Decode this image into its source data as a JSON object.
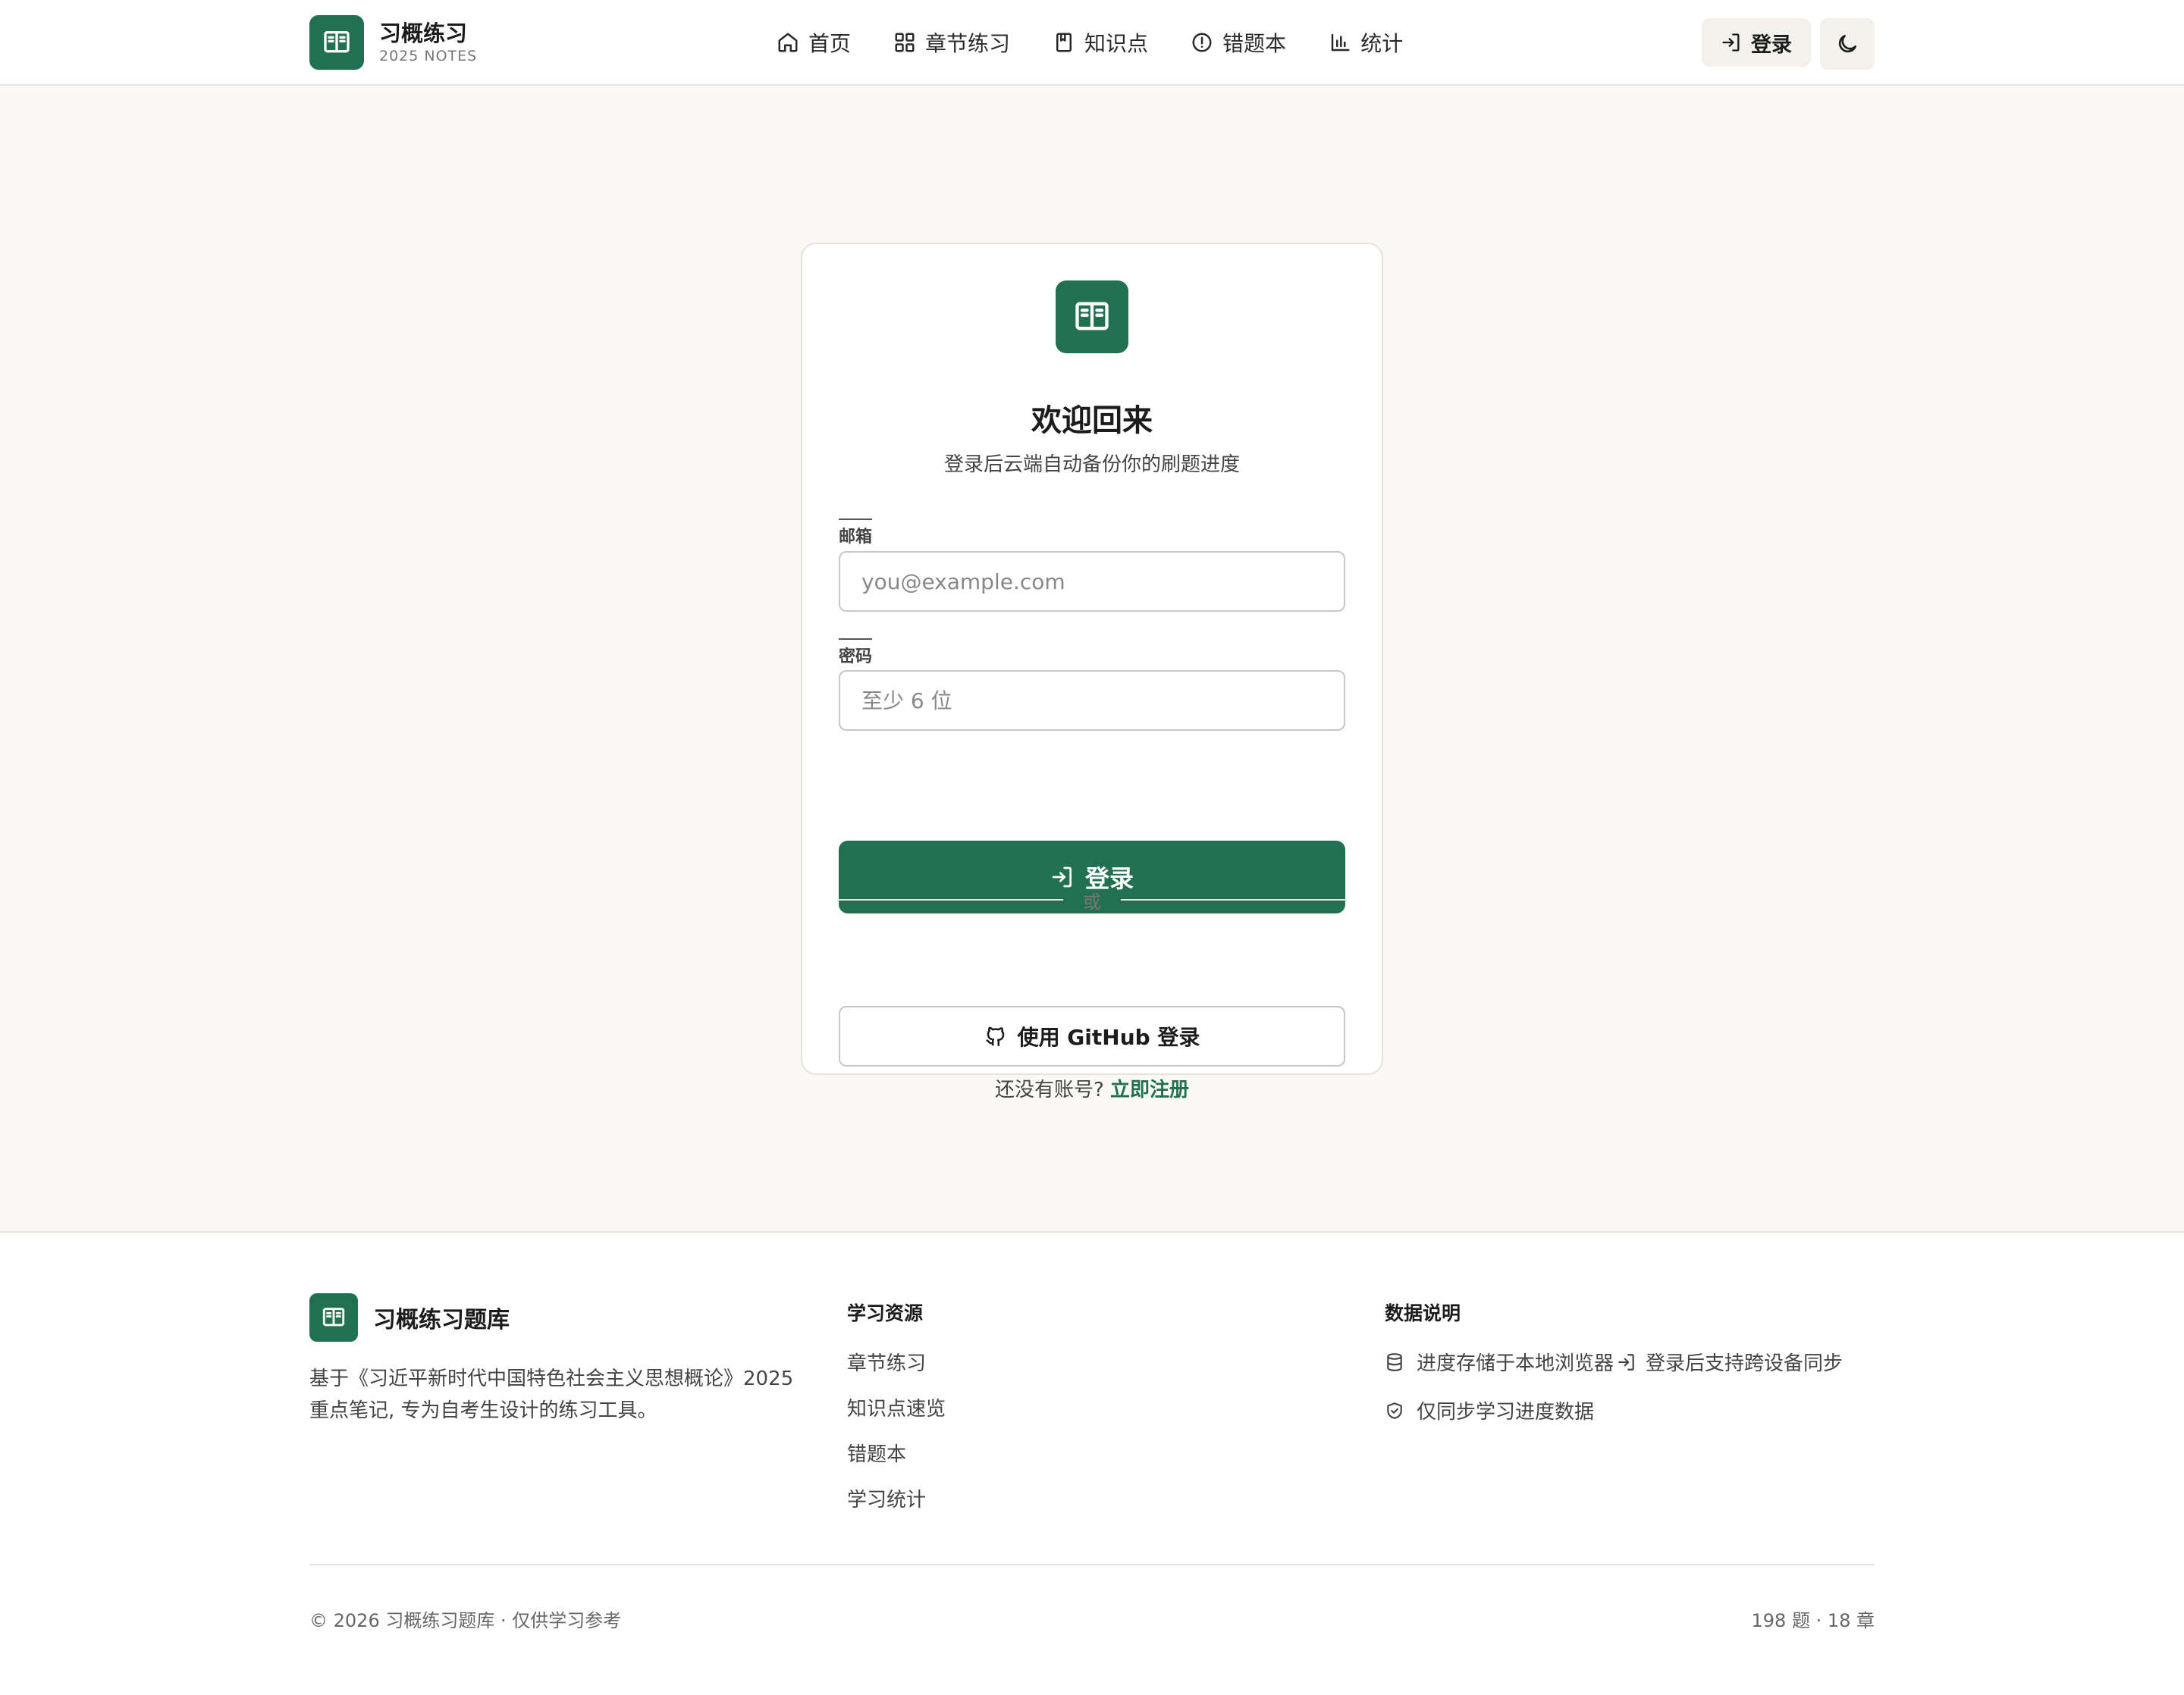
{
  "header": {
    "brand_title": "习概练习",
    "brand_subtitle": "2025 NOTES",
    "nav": [
      {
        "label": "首页",
        "icon": "home-icon"
      },
      {
        "label": "章节练习",
        "icon": "grid-icon"
      },
      {
        "label": "知识点",
        "icon": "bookmark-icon"
      },
      {
        "label": "错题本",
        "icon": "alert-circle-icon"
      },
      {
        "label": "统计",
        "icon": "bar-chart-icon"
      }
    ],
    "login_label": "登录",
    "theme_icon": "moon-icon"
  },
  "login_card": {
    "title": "欢迎回来",
    "subtitle": "登录后云端自动备份你的刷题进度",
    "email_label": "邮箱",
    "email_placeholder": "you@example.com",
    "email_value": "",
    "password_label": "密码",
    "password_placeholder": "至少 6 位",
    "password_value": "",
    "submit_label": "登录",
    "divider_text": "或",
    "github_label": "使用 GitHub 登录",
    "signup_prompt": "还没有账号?",
    "signup_link": "立即注册"
  },
  "footer": {
    "brand_title": "习概练习题库",
    "description": "基于《习近平新时代中国特色社会主义思想概论》2025 重点笔记, 专为自考生设计的练习工具。",
    "resources_heading": "学习资源",
    "resources": [
      "章节练习",
      "知识点速览",
      "错题本",
      "学习统计"
    ],
    "data_heading": "数据说明",
    "notes": [
      {
        "text": "进度存储于本地浏览器",
        "suffix": "登录后支持跨设备同步",
        "icon": "database-icon"
      },
      {
        "text": "仅同步学习进度数据",
        "icon": "shield-check-icon"
      }
    ],
    "copyright": "© 2026 习概练习题库 · 仅供学习参考",
    "stats": "198 题 · 18 章"
  },
  "colors": {
    "brand": "#217052",
    "page_background": "#faf9f6",
    "card_background": "#ffffff",
    "border": "#e6e3dc"
  }
}
